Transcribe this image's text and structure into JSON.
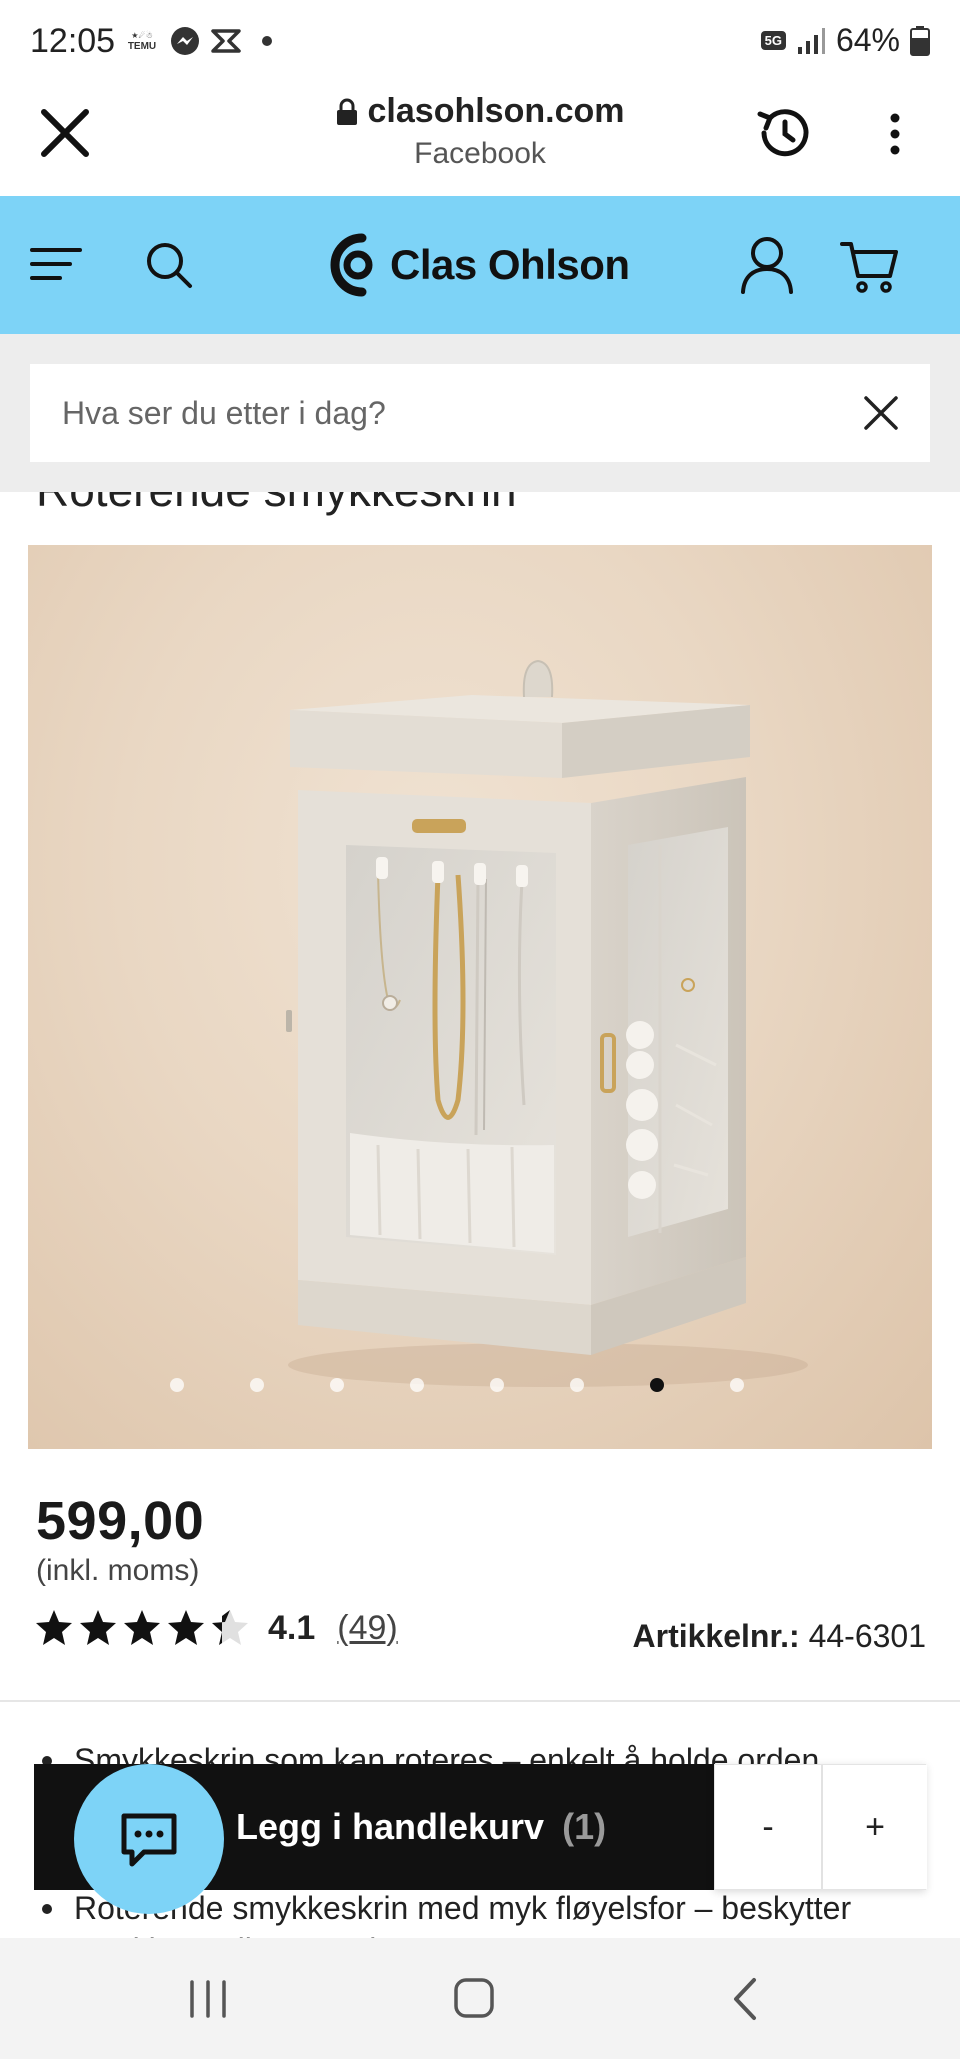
{
  "status_bar": {
    "time": "12:05",
    "left_icons": [
      "temu-icon",
      "messenger-icon",
      "capcut-icon",
      "dot-icon"
    ],
    "temu_label_top": "★☄☃",
    "temu_label": "TEMU",
    "network": "5G",
    "battery": "64%"
  },
  "browser": {
    "url": "clasohlson.com",
    "referrer": "Facebook"
  },
  "header": {
    "logo_text": "Clas Ohlson",
    "accent_color": "#7dd3f7"
  },
  "search": {
    "placeholder": "Hva ser du etter i dag?"
  },
  "product": {
    "title": "Roterende smykkeskrin",
    "price": "599,00",
    "price_note": "(inkl. moms)",
    "rating_value": "4.1",
    "rating_stars": 4.1,
    "rating_count": "(49)",
    "article_label": "Artikkelnr.:",
    "article_number": "44-6301",
    "image_count": 8,
    "active_image": 7
  },
  "description": {
    "bullet_1": "Smykkeskrin som kan roteres – enkelt å holde orden",
    "bullet_2": "Roterende smykkeskrin med myk fløyelsfor – beskytter",
    "bullet_2_cont": "smykkene dine mot riper"
  },
  "cart_bar": {
    "add_label": "Legg i handlekurv",
    "add_qty": "(1)",
    "minus": "-",
    "plus": "+"
  }
}
